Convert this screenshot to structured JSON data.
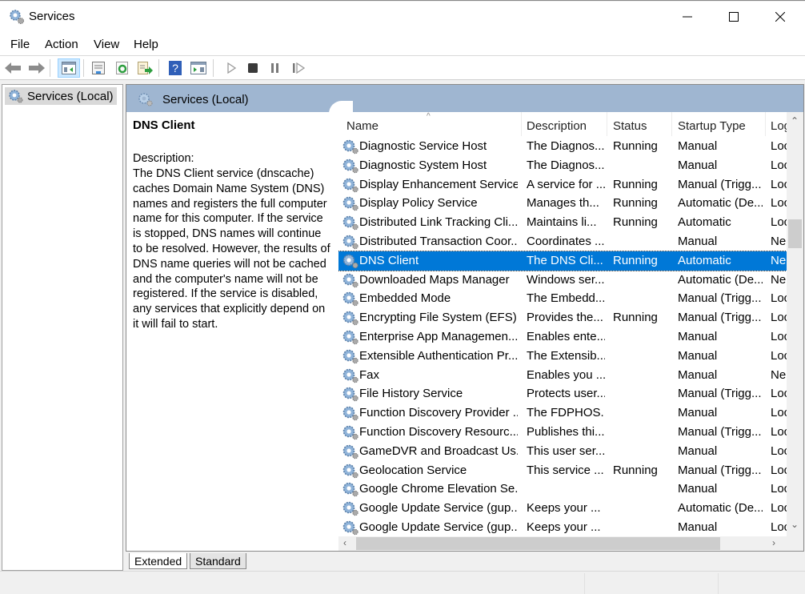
{
  "window": {
    "title": "Services",
    "controls": [
      "minimize",
      "maximize",
      "close"
    ]
  },
  "menu": [
    "File",
    "Action",
    "View",
    "Help"
  ],
  "toolbar": {
    "buttons": [
      {
        "name": "back-button",
        "icon": "arrow-left-icon"
      },
      {
        "name": "forward-button",
        "icon": "arrow-right-icon"
      },
      {
        "name": "show-hide-console-tree-button",
        "icon": "console-tree-icon",
        "active": true
      },
      {
        "name": "properties-button",
        "icon": "properties-icon"
      },
      {
        "name": "refresh-button",
        "icon": "refresh-icon"
      },
      {
        "name": "export-list-button",
        "icon": "export-icon"
      },
      {
        "name": "help-button",
        "icon": "help-icon"
      },
      {
        "name": "show-action-pane-button",
        "icon": "action-pane-icon"
      },
      {
        "name": "start-service-button",
        "icon": "play-icon"
      },
      {
        "name": "stop-service-button",
        "icon": "stop-icon"
      },
      {
        "name": "pause-service-button",
        "icon": "pause-icon"
      },
      {
        "name": "restart-service-button",
        "icon": "restart-icon"
      }
    ]
  },
  "tree": {
    "items": [
      {
        "label": "Services (Local)",
        "icon": "gear-icon"
      }
    ]
  },
  "content": {
    "header": "Services (Local)",
    "detail": {
      "title": "DNS Client",
      "description_label": "Description:",
      "description": "The DNS Client service (dnscache) caches Domain Name System (DNS) names and registers the full computer name for this computer. If the service is stopped, DNS names will continue to be resolved. However, the results of DNS name queries will not be cached and the computer's name will not be registered. If the service is disabled, any services that explicitly depend on it will fail to start."
    },
    "columns": [
      "Name",
      "Description",
      "Status",
      "Startup Type",
      "Log"
    ],
    "sorted_column": "Name",
    "rows": [
      {
        "name": "Diagnostic Service Host",
        "description": "The Diagnos...",
        "status": "Running",
        "startup": "Manual",
        "logon": "Loc"
      },
      {
        "name": "Diagnostic System Host",
        "description": "The Diagnos...",
        "status": "",
        "startup": "Manual",
        "logon": "Loc"
      },
      {
        "name": "Display Enhancement Service",
        "description": "A service for ...",
        "status": "Running",
        "startup": "Manual (Trigg...",
        "logon": "Loc"
      },
      {
        "name": "Display Policy Service",
        "description": "Manages th...",
        "status": "Running",
        "startup": "Automatic (De...",
        "logon": "Loc"
      },
      {
        "name": "Distributed Link Tracking Cli...",
        "description": "Maintains li...",
        "status": "Running",
        "startup": "Automatic",
        "logon": "Loc"
      },
      {
        "name": "Distributed Transaction Coor...",
        "description": "Coordinates ...",
        "status": "",
        "startup": "Manual",
        "logon": "Ne"
      },
      {
        "name": "DNS Client",
        "description": "The DNS Cli...",
        "status": "Running",
        "startup": "Automatic",
        "logon": "Ne",
        "selected": true
      },
      {
        "name": "Downloaded Maps Manager",
        "description": "Windows ser...",
        "status": "",
        "startup": "Automatic (De...",
        "logon": "Ne"
      },
      {
        "name": "Embedded Mode",
        "description": "The Embedd...",
        "status": "",
        "startup": "Manual (Trigg...",
        "logon": "Loc"
      },
      {
        "name": "Encrypting File System (EFS)",
        "description": "Provides the...",
        "status": "Running",
        "startup": "Manual (Trigg...",
        "logon": "Loc"
      },
      {
        "name": "Enterprise App Managemen...",
        "description": "Enables ente...",
        "status": "",
        "startup": "Manual",
        "logon": "Loc"
      },
      {
        "name": "Extensible Authentication Pr...",
        "description": "The Extensib...",
        "status": "",
        "startup": "Manual",
        "logon": "Loc"
      },
      {
        "name": "Fax",
        "description": "Enables you ...",
        "status": "",
        "startup": "Manual",
        "logon": "Ne"
      },
      {
        "name": "File History Service",
        "description": "Protects user...",
        "status": "",
        "startup": "Manual (Trigg...",
        "logon": "Loc"
      },
      {
        "name": "Function Discovery Provider ...",
        "description": "The FDPHOS...",
        "status": "",
        "startup": "Manual",
        "logon": "Loc"
      },
      {
        "name": "Function Discovery Resourc...",
        "description": "Publishes thi...",
        "status": "",
        "startup": "Manual (Trigg...",
        "logon": "Loc"
      },
      {
        "name": "GameDVR and Broadcast Us...",
        "description": "This user ser...",
        "status": "",
        "startup": "Manual",
        "logon": "Loc"
      },
      {
        "name": "Geolocation Service",
        "description": "This service ...",
        "status": "Running",
        "startup": "Manual (Trigg...",
        "logon": "Loc"
      },
      {
        "name": "Google Chrome Elevation Se...",
        "description": "",
        "status": "",
        "startup": "Manual",
        "logon": "Loc"
      },
      {
        "name": "Google Update Service (gup...",
        "description": "Keeps your ...",
        "status": "",
        "startup": "Automatic (De...",
        "logon": "Loc"
      },
      {
        "name": "Google Update Service (gup...",
        "description": "Keeps your ...",
        "status": "",
        "startup": "Manual",
        "logon": "Loc"
      }
    ]
  },
  "tabs": [
    {
      "label": "Extended",
      "active": true
    },
    {
      "label": "Standard",
      "active": false
    }
  ],
  "colors": {
    "selection": "#0078d7",
    "header_band": "#9fb6d1"
  }
}
